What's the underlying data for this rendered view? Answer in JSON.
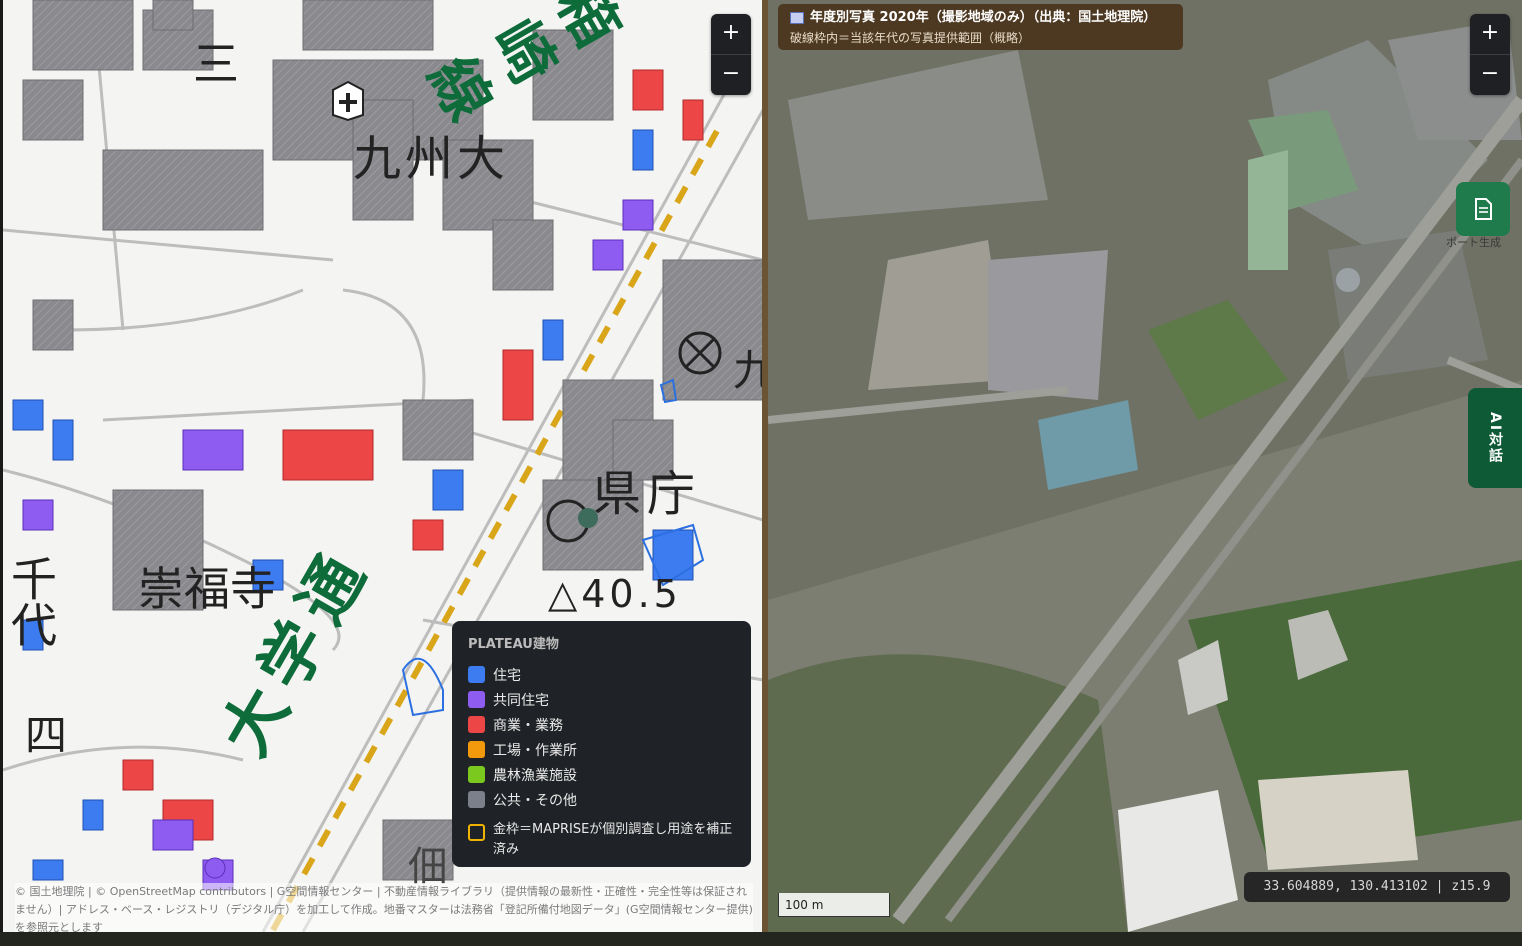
{
  "left_map": {
    "labels": {
      "kyudai": "九州大",
      "line_name": "箱崎線",
      "kencho": "県庁",
      "sofukuji": "崇福寺",
      "chiyo": "千代",
      "daigaku_dori": "大学通",
      "elevation": "△40.5",
      "chome_3": "三",
      "chome_4": "四",
      "edge_kyu": "九",
      "bottom_char": "佃"
    },
    "zoom": {
      "in_label": "+",
      "out_label": "−"
    }
  },
  "legend": {
    "title": "PLATEAU建物",
    "items": [
      {
        "label": "住宅",
        "color": "#3d7cf0"
      },
      {
        "label": "共同住宅",
        "color": "#8f5cf2"
      },
      {
        "label": "商業・業務",
        "color": "#ec4646"
      },
      {
        "label": "工場・作業所",
        "color": "#f39a0c"
      },
      {
        "label": "農林漁業施設",
        "color": "#7bc81e"
      },
      {
        "label": "公共・その他",
        "color": "#7c808a"
      }
    ],
    "note": "金枠＝MAPRISEが個別調査し用途を補正済み"
  },
  "attribution": "© 国土地理院 | © OpenStreetMap contributors | G空間情報センター | 不動産情報ライブラリ（提供情報の最新性・正確性・完全性等は保証されません）| アドレス・ベース・レジストリ（デジタル庁）を加工して作成。地番マスターは法務省「登記所備付地図データ」(G空間情報センター提供) を参照元とします",
  "right_map": {
    "banner_title": "年度別写真 2020年（撮影地域のみ）（出典：国土地理院）",
    "banner_subtitle": "破線枠内＝当該年代の写真提供範囲（概略）",
    "zoom": {
      "in_label": "+",
      "out_label": "−"
    },
    "report_label": "ポート生成",
    "ai_label": "AI対話",
    "coordinates": "33.604889, 130.413102 | z15.9",
    "scale_label": "100 m"
  },
  "colors": {
    "residential": "#3d7cf0",
    "apartment": "#8f5cf2",
    "commercial": "#ec4646",
    "factory": "#f39a0c",
    "agri": "#7bc81e",
    "public": "#7c808a",
    "label_green": "#0e6b3a"
  }
}
